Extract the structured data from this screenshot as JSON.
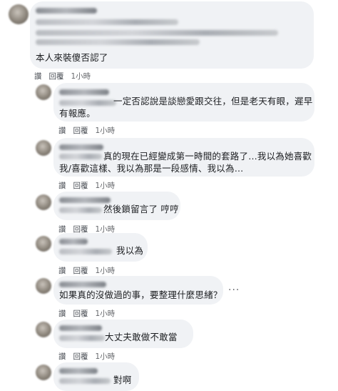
{
  "actions": {
    "like": "讚",
    "reply": "回覆"
  },
  "more_icon": "···",
  "comments": [
    {
      "text": "本人來裝傻否認了",
      "time": "1小時"
    },
    {
      "text_line1": "一定否認說是談戀愛跟交往，但是老天有眼，遲早",
      "text_line2": "有報應。",
      "time": "1小時"
    },
    {
      "text_line1": "真的現在已經變成第一時間的套路了…我以為她喜歡",
      "text_line2": "我/喜歡這樣、我以為那是一段感情、我以為…",
      "time": "1小時"
    },
    {
      "text": "然後鎖留言了 哼哼",
      "time": "1小時"
    },
    {
      "text": "我以為",
      "time": "1小時"
    },
    {
      "text": "如果真的沒做過的事，要整理什麼思緒？",
      "time": "1小時"
    },
    {
      "text": "大丈夫敢做不敢當",
      "time": "1小時"
    },
    {
      "text": "對啊"
    }
  ]
}
